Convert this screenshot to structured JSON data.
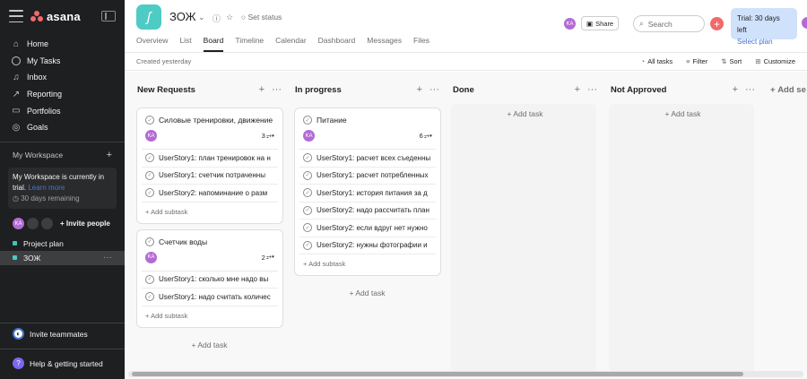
{
  "brand": {
    "name": "asana"
  },
  "sidebar": {
    "nav": [
      {
        "label": "Home",
        "icon": "home-icon"
      },
      {
        "label": "My Tasks",
        "icon": "check-circle-icon"
      },
      {
        "label": "Inbox",
        "icon": "inbox-icon"
      },
      {
        "label": "Reporting",
        "icon": "chart-icon"
      },
      {
        "label": "Portfolios",
        "icon": "portfolio-icon"
      },
      {
        "label": "Goals",
        "icon": "goal-icon"
      }
    ],
    "workspace_label": "My Workspace",
    "trial": {
      "line1": "My Workspace is currently in trial.",
      "link": "Learn more",
      "remaining": "30 days remaining"
    },
    "avatar_initials": "KA",
    "invite_people": "Invite people",
    "projects": [
      {
        "label": "Project plan",
        "color": "#3fc5b4"
      },
      {
        "label": "ЗОЖ",
        "color": "#4ecbc4"
      }
    ],
    "invite_teammates": "Invite teammates",
    "help": "Help & getting started"
  },
  "header": {
    "project_title": "ЗОЖ",
    "set_status": "Set status",
    "tabs": [
      "Overview",
      "List",
      "Board",
      "Timeline",
      "Calendar",
      "Dashboard",
      "Messages",
      "Files"
    ],
    "active_tab": "Board",
    "avatar_initials": "KA",
    "share": "Share",
    "search_placeholder": "Search",
    "trial_text": "Trial: 30 days left",
    "trial_link": "Select plan"
  },
  "subbar": {
    "created": "Created yesterday",
    "tools": [
      "All tasks",
      "Filter",
      "Sort",
      "Customize"
    ]
  },
  "board": {
    "add_section": "Add se",
    "add_task": "Add task",
    "add_subtask": "Add subtask",
    "columns": [
      {
        "title": "New Requests",
        "cards": [
          {
            "title": "Силовые тренировки, движение",
            "assignee": "KA",
            "subtask_count": "3",
            "subtasks": [
              "UserStory1: план тренировок на н",
              "UserStory1: счетчик потраченны",
              "UserStory2: напоминание о разм"
            ]
          },
          {
            "title": "Счетчик воды",
            "assignee": "KA",
            "subtask_count": "2",
            "subtasks": [
              "UserStory1: сколько мне надо вы",
              "UserStory1: надо считать количес"
            ]
          }
        ]
      },
      {
        "title": "In progress",
        "cards": [
          {
            "title": "Питание",
            "assignee": "KA",
            "subtask_count": "6",
            "subtasks": [
              "UserStory1: расчет всех съеденны",
              "UserStory1: расчет потребленных",
              "UserStory1: история питания за д",
              "UserStory2: надо рассчитать план",
              "UserStory2: если вдруг нет нужно",
              "UserStory2: нужны фотографии и"
            ]
          }
        ]
      },
      {
        "title": "Done",
        "cards": []
      },
      {
        "title": "Not Approved",
        "cards": []
      }
    ]
  }
}
